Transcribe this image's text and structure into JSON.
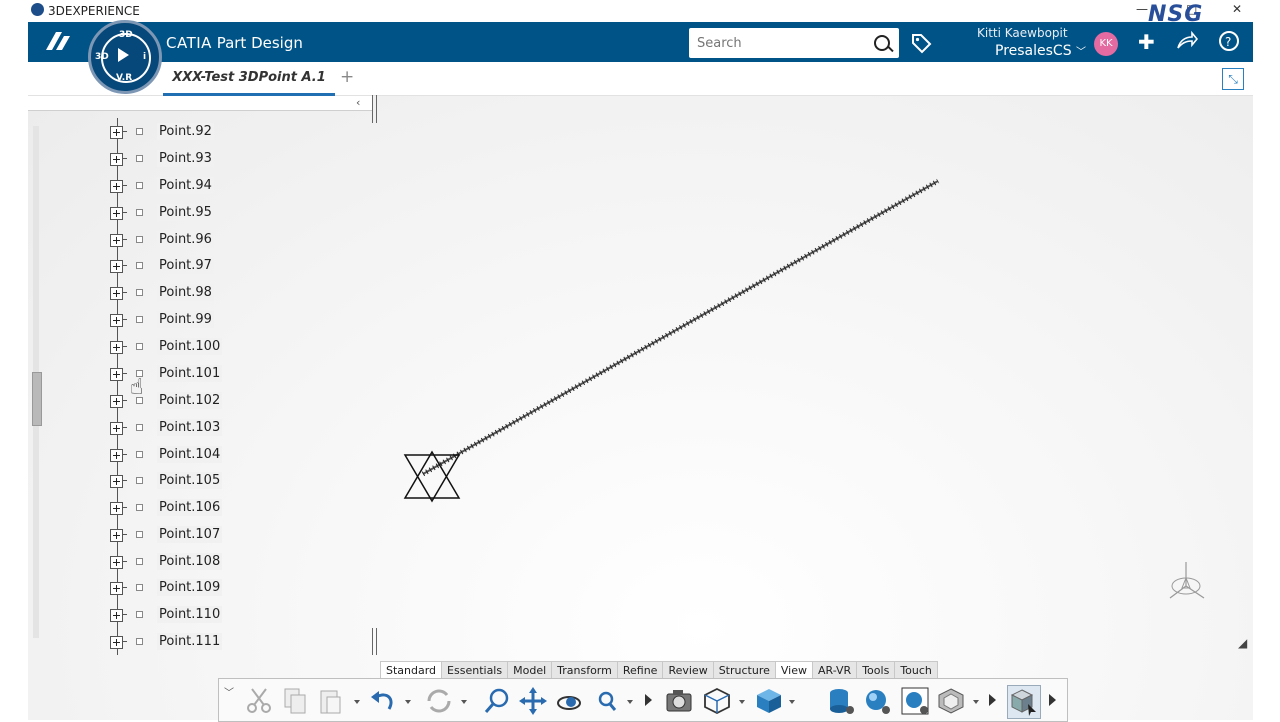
{
  "app": {
    "window_title": "3DEXPERIENCE",
    "brand": "CATIA",
    "app_name": "Part Design",
    "compass_top": "3D",
    "compass_bottom": "V.R",
    "compass_left": "3D",
    "compass_right": "i",
    "watermark": "NSG"
  },
  "header": {
    "search_placeholder": "Search",
    "user_name": "Kitti Kaewbopit",
    "tenant": "PresalesCS",
    "avatar_initials": "KK"
  },
  "tabs": {
    "document_tab": "XXX-Test 3DPoint A.1",
    "add_tab": "+"
  },
  "tree": {
    "items": [
      "Point.92",
      "Point.93",
      "Point.94",
      "Point.95",
      "Point.96",
      "Point.97",
      "Point.98",
      "Point.99",
      "Point.100",
      "Point.101",
      "Point.102",
      "Point.103",
      "Point.104",
      "Point.105",
      "Point.106",
      "Point.107",
      "Point.108",
      "Point.109",
      "Point.110",
      "Point.111"
    ]
  },
  "section_tabs": [
    "Standard",
    "Essentials",
    "Model",
    "Transform",
    "Refine",
    "Review",
    "Structure",
    "View",
    "AR-VR",
    "Tools",
    "Touch"
  ],
  "active_section": "Standard",
  "selected_section": "View",
  "action_bar": {
    "buttons": [
      "cut-icon",
      "copy-icon",
      "paste-icon",
      "undo-icon",
      "update-icon",
      "zoom-icon",
      "pan-icon",
      "rotate-icon",
      "search-icon",
      "capture-icon",
      "view-mode-icon",
      "shading-icon",
      "database-icon",
      "render-icon",
      "environment-icon",
      "model-icon",
      "cube-select-icon"
    ]
  },
  "colors": {
    "topbar": "#005386",
    "accent": "#1f6fb2"
  }
}
